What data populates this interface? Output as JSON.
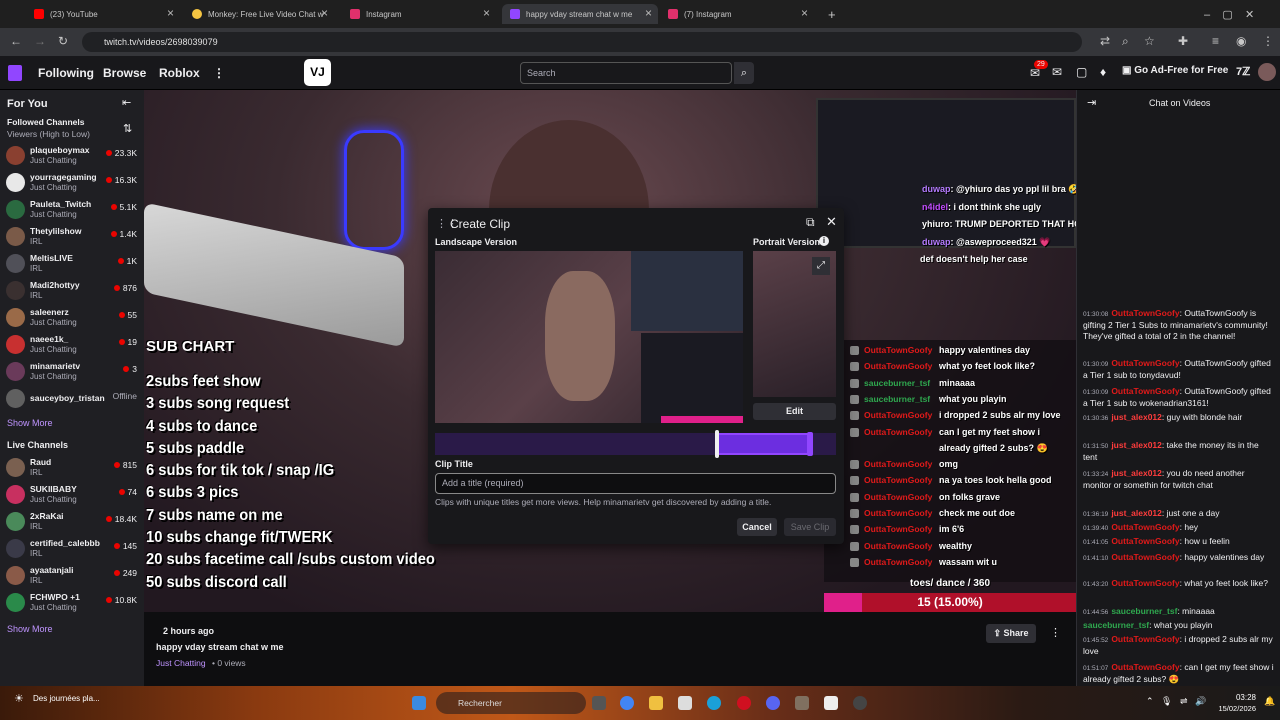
{
  "browser": {
    "tabs": [
      {
        "label": "(23) YouTube",
        "color": "#ff0000"
      },
      {
        "label": "Monkey: Free Live Video Chat w",
        "color": "#f5c542"
      },
      {
        "label": "Instagram",
        "color": "#e1306c"
      },
      {
        "label": "happy vday stream chat w me",
        "color": "#9146ff"
      },
      {
        "label": "(7) Instagram",
        "color": "#e1306c"
      }
    ],
    "url": "twitch.tv/videos/2698039079"
  },
  "topnav": {
    "following": "Following",
    "browse": "Browse",
    "roblox": "Roblox",
    "more": "⋮",
    "search_placeholder": "Search",
    "notif_count": "29",
    "ad_free": "Go Ad-Free for Free"
  },
  "sidebar": {
    "for_you": "For You",
    "followed_title": "Followed Channels",
    "followed_sort": "Viewers (High to Low)",
    "followed": [
      {
        "name": "plaqueboymax",
        "cat": "Just Chatting",
        "viewers": "23.3K",
        "color": "#8a4030"
      },
      {
        "name": "yourragegaming",
        "cat": "Just Chatting",
        "viewers": "16.3K",
        "color": "#e8e8e8"
      },
      {
        "name": "Pauleta_Twitch",
        "cat": "Just Chatting",
        "viewers": "5.1K",
        "color": "#2a6a40"
      },
      {
        "name": "Thetylilshow",
        "cat": "IRL",
        "viewers": "1.4K",
        "color": "#7a5a48"
      },
      {
        "name": "MeltisLIVE",
        "cat": "IRL",
        "viewers": "1K",
        "color": "#505058"
      },
      {
        "name": "Madi2hottyy",
        "cat": "IRL",
        "viewers": "876",
        "color": "#3a3030"
      },
      {
        "name": "saleenerz",
        "cat": "Just Chatting",
        "viewers": "55",
        "color": "#9a6a48"
      },
      {
        "name": "naeee1k_",
        "cat": "Just Chatting",
        "viewers": "19",
        "color": "#c83030"
      },
      {
        "name": "minamarietv",
        "cat": "Just Chatting",
        "viewers": "3",
        "color": "#6a3a5a"
      },
      {
        "name": "sauceyboy_tristan",
        "cat": "",
        "viewers": "Offline",
        "color": "#606060"
      }
    ],
    "show_more": "Show More",
    "live_title": "Live Channels",
    "live": [
      {
        "name": "Raud",
        "cat": "IRL",
        "viewers": "815",
        "color": "#7a6050"
      },
      {
        "name": "SUKIIBABY",
        "cat": "Just Chatting",
        "viewers": "74",
        "color": "#c83060"
      },
      {
        "name": "2xRaKai",
        "cat": "IRL",
        "viewers": "18.4K",
        "color": "#4a8a5a"
      },
      {
        "name": "certified_calebbb",
        "cat": "IRL",
        "viewers": "145",
        "color": "#3a3a48"
      },
      {
        "name": "ayaatanjali",
        "cat": "IRL",
        "viewers": "249",
        "color": "#8a5a48"
      },
      {
        "name": "FCHWPO +1",
        "cat": "Just Chatting",
        "viewers": "10.8K",
        "color": "#2a8a4a"
      }
    ]
  },
  "video": {
    "sub_chart_title": "SUB CHART",
    "sub_chart": [
      "2subs feet show",
      "3 subs song request",
      "4 subs to dance",
      "5 subs paddle",
      "6 subs for tik tok / snap /IG",
      "6 subs 3 pics",
      "7 subs name on me",
      "10 subs change fit/TWERK",
      "20 subs facetime call /subs custom video",
      "50 subs discord call"
    ],
    "overlay_chat": [
      {
        "user": "duwap",
        "msg": ": @yhiuro das yo ppl lil bra 🤣🤣🤣🤣🤣",
        "color": "#b57bff"
      },
      {
        "user": "n4idel",
        "msg": ": i dont think she ugly",
        "color": "#c04cfd"
      },
      {
        "user": "yhiuro",
        "msg": ": TRUMP DEPORTED THAT HOE",
        "color": "#ffffff"
      },
      {
        "user": "duwap",
        "msg": ": @asweproceed321 💗",
        "color": "#b57bff"
      },
      {
        "user": "",
        "msg": "def doesn't help her case",
        "color": "#ffffff"
      }
    ],
    "video_chat": [
      {
        "user": "OuttaTownGoofy",
        "msg": "happy valentines day",
        "color": "#e01a1a"
      },
      {
        "user": "OuttaTownGoofy",
        "msg": "what yo feet look like?",
        "color": "#e01a1a"
      },
      {
        "user": "sauceburner_tsf",
        "msg": "minaaaa",
        "color": "#2fa84f"
      },
      {
        "user": "sauceburner_tsf",
        "msg": "what you playin",
        "color": "#2fa84f"
      },
      {
        "user": "OuttaTownGoofy",
        "msg": "i dropped 2 subs alr my love",
        "color": "#e01a1a"
      },
      {
        "user": "OuttaTownGoofy",
        "msg": "can I get my feet show i",
        "color": "#e01a1a"
      },
      {
        "user": "",
        "msg": "already gifted 2 subs? 😍",
        "color": "#e01a1a"
      },
      {
        "user": "OuttaTownGoofy",
        "msg": "omg",
        "color": "#e01a1a"
      },
      {
        "user": "OuttaTownGoofy",
        "msg": "na ya toes look hella good",
        "color": "#e01a1a"
      },
      {
        "user": "OuttaTownGoofy",
        "msg": "on folks grave",
        "color": "#e01a1a"
      },
      {
        "user": "OuttaTownGoofy",
        "msg": "check me out doe",
        "color": "#e01a1a"
      },
      {
        "user": "OuttaTownGoofy",
        "msg": "im 6'6",
        "color": "#e01a1a"
      },
      {
        "user": "OuttaTownGoofy",
        "msg": "wealthy",
        "color": "#e01a1a"
      },
      {
        "user": "OuttaTownGoofy",
        "msg": "wassam wit u",
        "color": "#e01a1a"
      }
    ],
    "goal_label": "toes/ dance / 360",
    "goal_value": "15 (15.00%)",
    "goal_fraction": 0.15
  },
  "clip": {
    "title": "Create Clip",
    "landscape": "Landscape Version",
    "portrait": "Portrait Version",
    "edit": "Edit",
    "clip_title_label": "Clip Title",
    "placeholder": "Add a title (required)",
    "hint": "Clips with unique titles get more views. Help minamarietv get discovered by adding a title.",
    "cancel": "Cancel",
    "save": "Save Clip"
  },
  "info": {
    "time_ago": "2 hours ago",
    "title": "happy vday stream chat w me",
    "category": "Just Chatting",
    "views": " • 0 views",
    "share": "Share"
  },
  "chat": {
    "header": "Chat on Videos",
    "messages": [
      {
        "ts": "01:30:08",
        "user": "OuttaTownGoofy",
        "text": ": OuttaTownGoofy is gifting 2 Tier 1 Subs to minamarietv's community! They've gifted a total of 2 in the channel!",
        "color": "#e01a1a"
      },
      {
        "ts": "01:30:09",
        "user": "OuttaTownGoofy",
        "text": ": OuttaTownGoofy gifted a Tier 1 sub to tonydavud!",
        "color": "#e01a1a"
      },
      {
        "ts": "01:30:09",
        "user": "OuttaTownGoofy",
        "text": ": OuttaTownGoofy gifted a Tier 1 sub to wokenadrian3161!",
        "color": "#e01a1a"
      },
      {
        "ts": "01:30:36",
        "user": "just_alex012",
        "text": ": guy with blonde hair",
        "color": "#ff3c3c"
      },
      {
        "ts": "01:31:50",
        "user": "just_alex012",
        "text": ": take the money its in the tent",
        "color": "#ff3c3c"
      },
      {
        "ts": "01:33:24",
        "user": "just_alex012",
        "text": ": you do need another monitor or somethin for twitch chat",
        "color": "#ff3c3c"
      },
      {
        "ts": "01:36:19",
        "user": "just_alex012",
        "text": ": just one a day",
        "color": "#ff3c3c"
      },
      {
        "ts": "01:39:40",
        "user": "OuttaTownGoofy",
        "text": ": hey",
        "color": "#e01a1a"
      },
      {
        "ts": "01:41:05",
        "user": "OuttaTownGoofy",
        "text": ": how u feelin",
        "color": "#e01a1a"
      },
      {
        "ts": "01:41:10",
        "user": "OuttaTownGoofy",
        "text": ": happy valentines day",
        "color": "#e01a1a"
      },
      {
        "ts": "01:43:20",
        "user": "OuttaTownGoofy",
        "text": ": what yo feet look like?",
        "color": "#e01a1a"
      },
      {
        "ts": "01:44:56",
        "user": "sauceburner_tsf",
        "text": ": minaaaa",
        "color": "#2fa84f"
      },
      {
        "ts": "",
        "user": "sauceburner_tsf",
        "text": ": what you playin",
        "color": "#2fa84f"
      },
      {
        "ts": "01:45:52",
        "user": "OuttaTownGoofy",
        "text": ": i dropped 2 subs alr my love",
        "color": "#e01a1a"
      },
      {
        "ts": "01:51:07",
        "user": "OuttaTownGoofy",
        "text": ": can I get my feet show i already gifted 2 subs? 😍",
        "color": "#e01a1a"
      }
    ]
  },
  "taskbar": {
    "weather": "Des journées pla...",
    "search": "Rechercher",
    "time": "03:28",
    "date": "15/02/2026"
  }
}
